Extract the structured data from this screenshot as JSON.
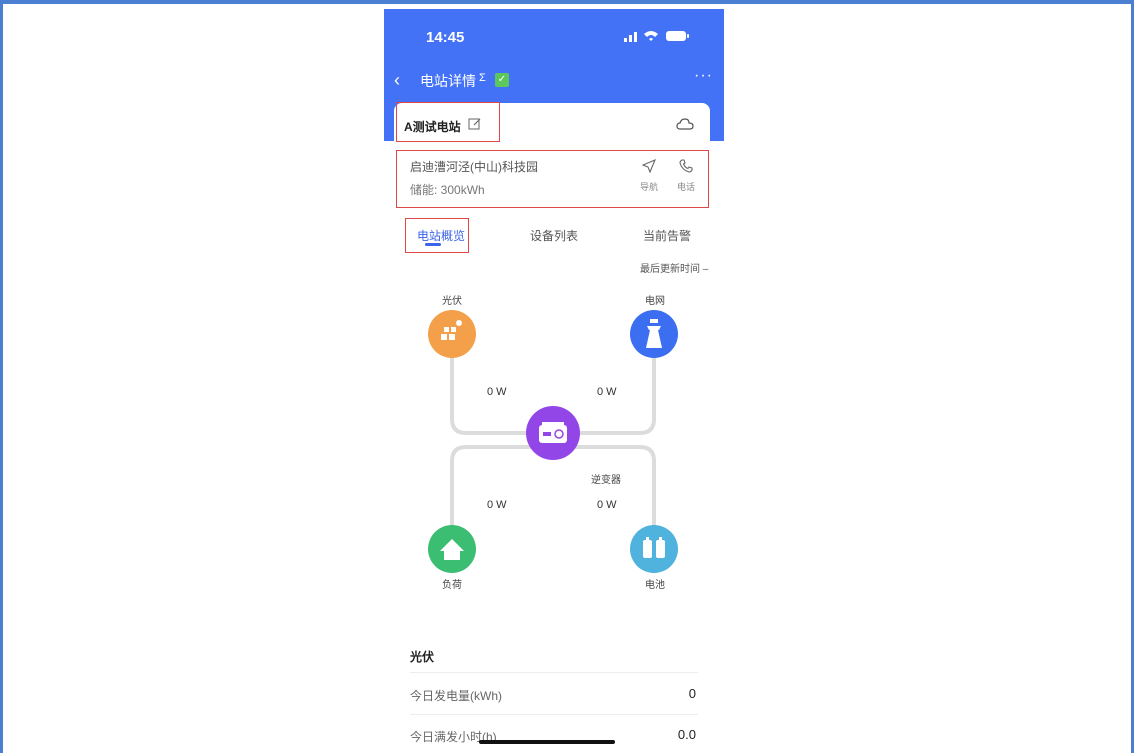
{
  "status_bar": {
    "time": "14:45"
  },
  "header": {
    "title": "电站详情",
    "sigma": "Σ",
    "check": "✓",
    "more": "···"
  },
  "station": {
    "name": "A测试电站",
    "address": "启迪漕河泾(中山)科技园",
    "capacity": "储能: 300kWh",
    "nav_label": "导航",
    "call_label": "电话"
  },
  "tabs": [
    {
      "label": "电站概览"
    },
    {
      "label": "设备列表"
    },
    {
      "label": "当前告警"
    }
  ],
  "last_updated": "最后更新时间 –",
  "flow": {
    "pv_label": "光伏",
    "grid_label": "电网",
    "inverter_label": "逆变器",
    "load_label": "负荷",
    "battery_label": "电池",
    "pv_power": "0 W",
    "grid_power": "0 W",
    "load_power": "0 W",
    "battery_power": "0 W",
    "colors": {
      "pv": "#f4a04a",
      "grid": "#3b6ef0",
      "inverter": "#9346e8",
      "load": "#3bbd72",
      "battery": "#4fb3de"
    }
  },
  "pv_section": {
    "title": "光伏",
    "rows": [
      {
        "label": "今日发电量(kWh)",
        "value": "0"
      },
      {
        "label": "今日满发小时(h)",
        "value": "0.0"
      }
    ]
  }
}
